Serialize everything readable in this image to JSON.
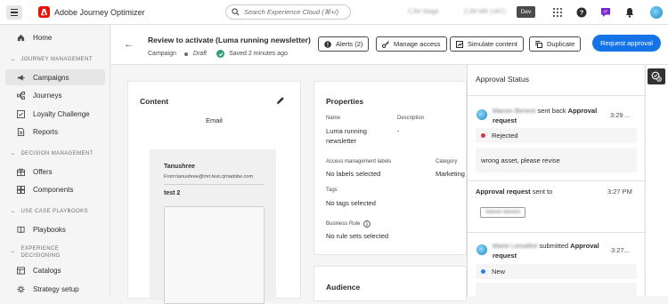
{
  "app": {
    "name": "Adobe Journey Optimizer",
    "search_placeholder": "Search Experience Cloud (⌘+/)",
    "org": "CJM Stage",
    "sandbox": "CJM MR (VA7)",
    "env_badge": "Dev"
  },
  "nav": {
    "home": "Home",
    "sec_journey": "JOURNEY MANAGEMENT",
    "campaigns": "Campaigns",
    "journeys": "Journeys",
    "loyalty": "Loyalty Challenge",
    "reports": "Reports",
    "sec_decision": "DECISION MANAGEMENT",
    "offers": "Offers",
    "components": "Components",
    "sec_playbooks": "USE CASE PLAYBOOKS",
    "playbooks": "Playbooks",
    "sec_exp_1": "EXPERIENCE",
    "sec_exp_2": "DECISIONING",
    "catalogs": "Catalogs",
    "strategy": "Strategy setup"
  },
  "header": {
    "title": "Review to activate (Luma running newsletter)",
    "type": "Campaign",
    "status": "Draft",
    "saved": "Saved 2 minutes ago",
    "alerts": "Alerts (2)",
    "manage_access": "Manage access",
    "simulate": "Simulate content",
    "duplicate": "Duplicate",
    "request": "Request approval"
  },
  "content": {
    "title": "Content",
    "channel": "Email",
    "sender_name": "Tanushree",
    "sender_from": "From:tanushree@mrt.test.cjmadobe.com",
    "subject": "test 2"
  },
  "properties": {
    "title": "Properties",
    "name_label": "Name",
    "name_line1": "Luma running",
    "name_line2": "newsletter",
    "desc_label": "Description",
    "desc_value": "-",
    "aml_label": "Access management labels",
    "aml_value": "No labels selected",
    "category_label": "Category",
    "category_value": "Marketing",
    "tags_label": "Tags",
    "tags_value": "No tags selected",
    "rule_label": "Business Rule",
    "rule_value": "No rule sets selected"
  },
  "audience": {
    "title": "Audience"
  },
  "approval": {
    "title": "Approval Status",
    "e1_name": "Manon Benest",
    "e1_action": "sent back",
    "e1_bold1": "Approval",
    "e1_bold2": "request",
    "e1_time": "3:29 ...",
    "e1_status": "Rejected",
    "e1_comment": "wrong asset, please revise",
    "e2_bold": "Approval request",
    "e2_action": "sent to",
    "e2_time": "3:27 PM",
    "e2_tag": "Manon Benest",
    "e3_name": "Marie Lemaître",
    "e3_action": "submitted",
    "e3_bold1": "Approval",
    "e3_bold2": "request",
    "e3_time": "3:27...",
    "e3_status": "New"
  },
  "colors": {
    "accent": "#1473e6",
    "rejected": "#d7373f",
    "new": "#2680eb",
    "saved": "#2d9d78",
    "brand": "#eb1000"
  }
}
